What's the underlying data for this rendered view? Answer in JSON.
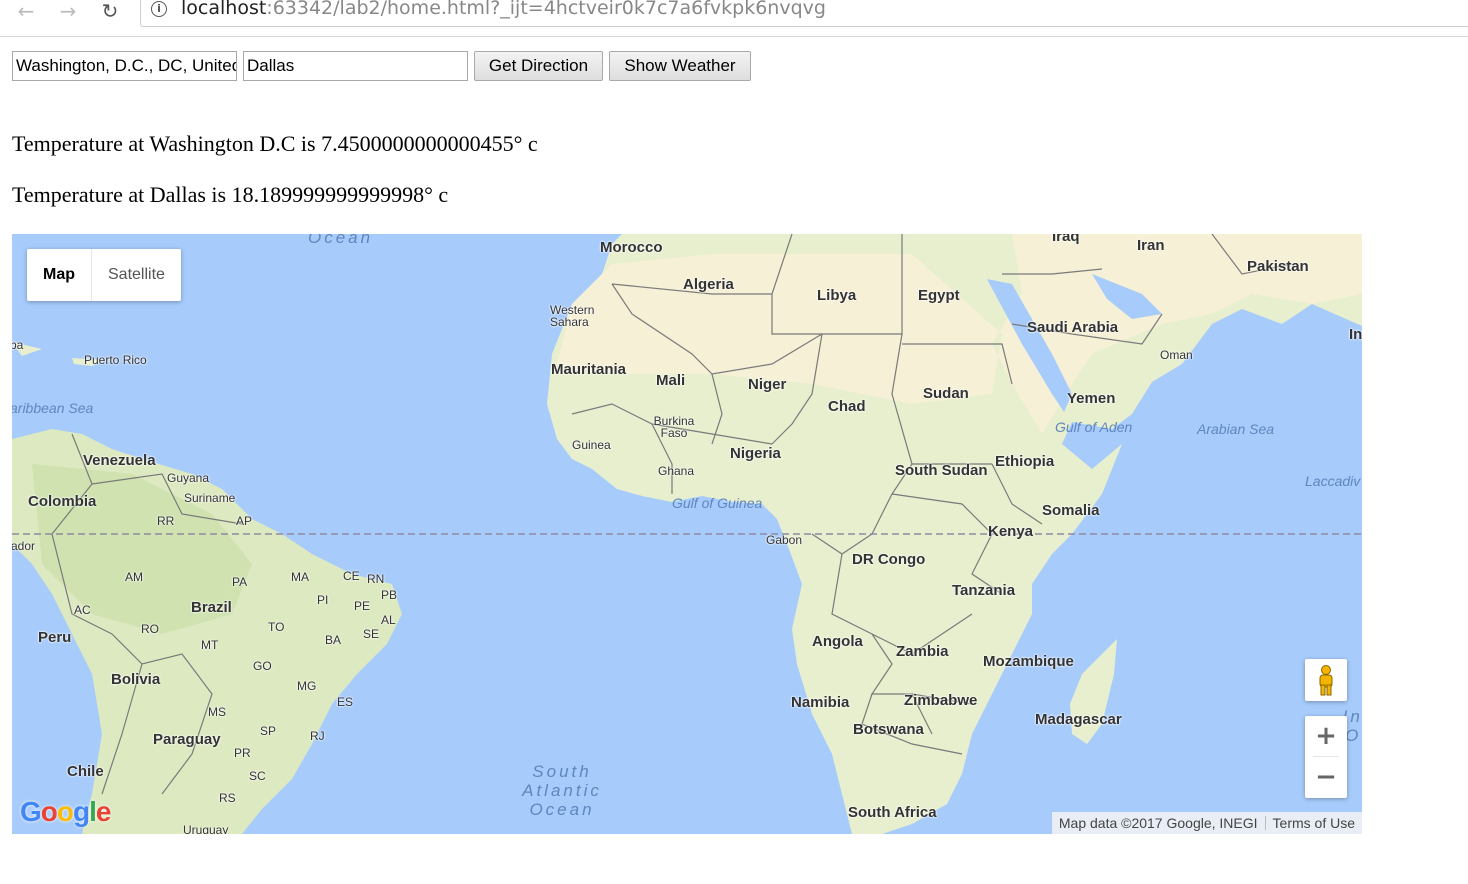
{
  "browser": {
    "url_host": "localhost",
    "url_path": ":63342/lab2/home.html?_ijt=4hctveir0k7c7a6fvkpk6nvqvg"
  },
  "form": {
    "origin_value": "Washington, D.C., DC, United States",
    "destination_value": "Dallas",
    "direction_label": "Get Direction",
    "weather_label": "Show Weather"
  },
  "weather": {
    "line1": "Temperature at Washington D.C is 7.4500000000000455° c",
    "line2": "Temperature at Dallas is 18.189999999999998° c"
  },
  "map": {
    "type_map": "Map",
    "type_satellite": "Satellite",
    "zoom_in": "+",
    "zoom_out": "−",
    "attribution": "Map data ©2017 Google, INEGI",
    "terms": "Terms of Use",
    "logo": "Google",
    "colors": {
      "water": "#a7cbfb",
      "land": "#e7efcf",
      "desert": "#f6f0d6",
      "border": "#7a7a7a"
    },
    "labels": {
      "ocean_north": "Ocean",
      "morocco": "Morocco",
      "algeria": "Algeria",
      "libya": "Libya",
      "egypt": "Egypt",
      "iraq": "Iraq",
      "iran": "Iran",
      "pakistan": "Pakistan",
      "india": "In",
      "saudi": "Saudi Arabia",
      "oman": "Oman",
      "yemen": "Yemen",
      "western_sahara": "Western Sahara",
      "mauritania": "Mauritania",
      "mali": "Mali",
      "niger": "Niger",
      "chad": "Chad",
      "sudan": "Sudan",
      "burkina": "Burkina Faso",
      "guinea": "Guinea",
      "ghana": "Ghana",
      "nigeria": "Nigeria",
      "south_sudan": "South Sudan",
      "ethiopia": "Ethiopia",
      "somalia": "Somalia",
      "kenya": "Kenya",
      "gabon": "Gabon",
      "drc": "DR Congo",
      "tanzania": "Tanzania",
      "angola": "Angola",
      "zambia": "Zambia",
      "mozambique": "Mozambique",
      "namibia": "Namibia",
      "zimbabwe": "Zimbabwe",
      "botswana": "Botswana",
      "madagascar": "Madagascar",
      "south_africa": "South Africa",
      "gulf_aden": "Gulf of Aden",
      "arabian_sea": "Arabian Sea",
      "laccadive": "Laccadiv",
      "gulf_guinea": "Gulf of Guinea",
      "caribbean": "aribbean Sea",
      "cuba": "ba",
      "puerto_rico": "Puerto Rico",
      "venezuela": "Venezuela",
      "guyana": "Guyana",
      "suriname": "Suriname",
      "colombia": "Colombia",
      "rr": "RR",
      "ap": "AP",
      "ecuador": "ador",
      "am": "AM",
      "pa": "PA",
      "ma": "MA",
      "ce": "CE",
      "rn": "RN",
      "pb": "PB",
      "pi": "PI",
      "pe": "PE",
      "al": "AL",
      "se": "SE",
      "ac": "AC",
      "brazil": "Brazil",
      "peru": "Peru",
      "ro": "RO",
      "to": "TO",
      "mt": "MT",
      "ba": "BA",
      "go": "GO",
      "bolivia": "Bolivia",
      "mg": "MG",
      "es": "ES",
      "ms": "MS",
      "sp": "SP",
      "rj": "RJ",
      "paraguay": "Paraguay",
      "pr": "PR",
      "chile": "Chile",
      "sc": "SC",
      "rs": "RS",
      "uruguay": "Uruguay",
      "south_atlantic": "South Atlantic Ocean",
      "indian_ocean": "Ind Oc"
    }
  }
}
